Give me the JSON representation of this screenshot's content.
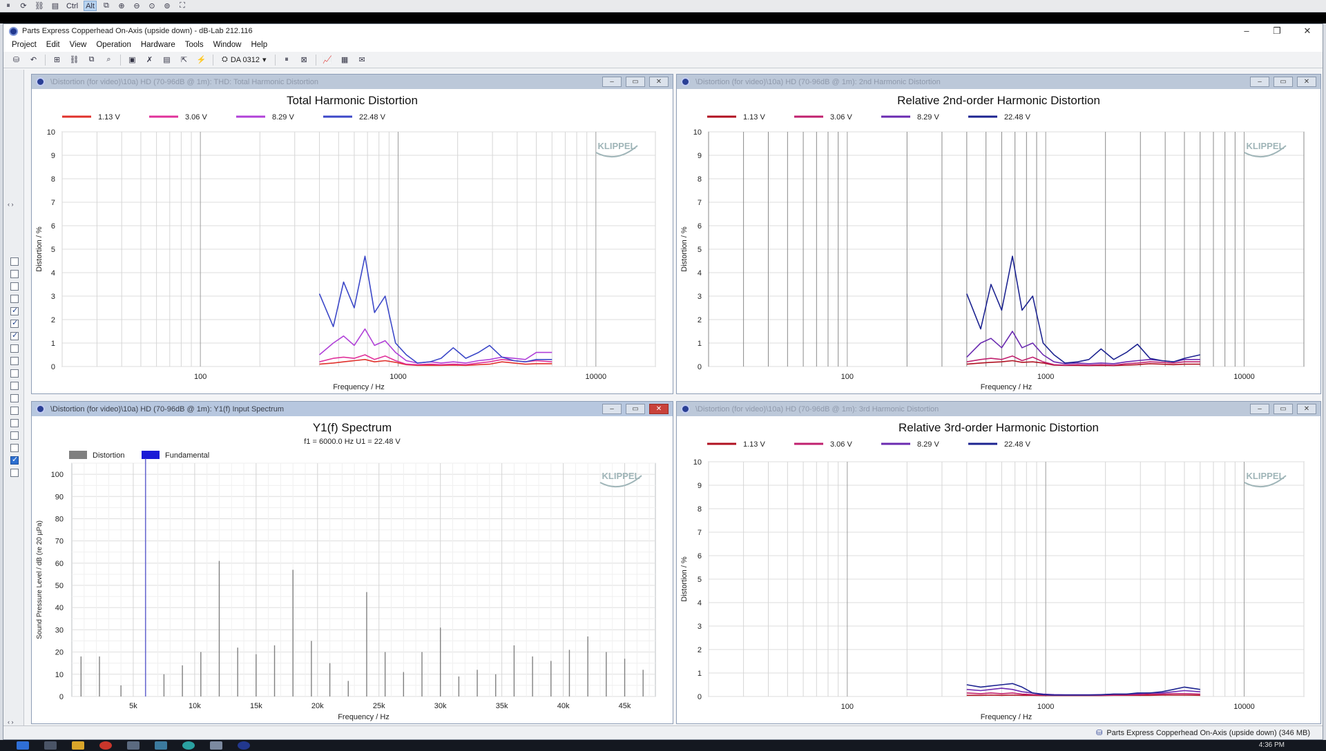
{
  "viewer": {
    "buttons": [
      {
        "name": "pause-icon",
        "glyph": "⏸",
        "on": false
      },
      {
        "name": "refresh-icon",
        "glyph": "⟳",
        "on": false
      },
      {
        "name": "link-icon",
        "glyph": "⛓",
        "on": false
      },
      {
        "name": "clipboard-icon",
        "glyph": "▤",
        "on": false
      },
      {
        "name": "ctrl-key-button",
        "glyph": "Ctrl",
        "on": false
      },
      {
        "name": "alt-key-button",
        "glyph": "Alt",
        "on": true
      },
      {
        "name": "copy-icon",
        "glyph": "⧉",
        "on": false
      },
      {
        "name": "zoom-in-icon",
        "glyph": "⊕",
        "on": false
      },
      {
        "name": "zoom-out-icon",
        "glyph": "⊖",
        "on": false
      },
      {
        "name": "zoom-fit-icon",
        "glyph": "⊙",
        "on": false
      },
      {
        "name": "zoom-actual-icon",
        "glyph": "⊚",
        "on": false
      },
      {
        "name": "fullscreen-icon",
        "glyph": "⛶",
        "on": false
      }
    ]
  },
  "app": {
    "title": "Parts Express Copperhead On-Axis (upside down) - dB-Lab 212.116",
    "win_min": "–",
    "win_max": "❐",
    "win_close": "✕"
  },
  "menu": [
    "Project",
    "Edit",
    "View",
    "Operation",
    "Hardware",
    "Tools",
    "Window",
    "Help"
  ],
  "toolbar": {
    "device": "DA 0312",
    "device_arrow": "▾"
  },
  "windows": {
    "thd": {
      "title": "\\Distortion (for video)\\10a) HD (70-96dB @ 1m): THD: Total Harmonic Distortion",
      "faded": true
    },
    "h2": {
      "title": "\\Distortion (for video)\\10a) HD (70-96dB @ 1m): 2nd Harmonic Distortion",
      "faded": true
    },
    "spectrum": {
      "title": "\\Distortion (for video)\\10a) HD (70-96dB @ 1m): Y1(f) Input Spectrum",
      "faded": false
    },
    "h3": {
      "title": "\\Distortion (for video)\\10a) HD (70-96dB @ 1m): 3rd Harmonic Distortion",
      "faded": true
    },
    "ctl": {
      "min": "–",
      "max": "▭",
      "close": "✕"
    }
  },
  "watermark": "KLIPPEL",
  "colors": {
    "v113": "#e0302b",
    "v306": "#e0309a",
    "v829": "#b040d8",
    "v2248": "#3b47c8",
    "v113_dark": "#b01020",
    "v306_dark": "#c0206e",
    "v829_dark": "#6a2ab0",
    "v2248_dark": "#1c2390",
    "distortion": "#808080",
    "fundamental": "#1a1ad6",
    "grid": "#d0d0d0"
  },
  "chart_data": [
    {
      "type": "line",
      "title": "Total Harmonic Distortion",
      "xlabel": "Frequency / Hz",
      "ylabel": "Distortion / %",
      "xscale": "log",
      "xlim": [
        20,
        20000
      ],
      "ylim": [
        0,
        10
      ],
      "xticks": [
        "100",
        "1000",
        "10000"
      ],
      "yticks": [
        "0",
        "1",
        "2",
        "3",
        "4",
        "5",
        "6",
        "7",
        "8",
        "9",
        "10"
      ],
      "x": [
        400,
        470,
        530,
        600,
        680,
        760,
        860,
        970,
        1100,
        1250,
        1450,
        1650,
        1900,
        2200,
        2550,
        2900,
        3350,
        3850,
        4400,
        5000,
        6000
      ],
      "series": [
        {
          "name": "1.13 V",
          "color_key": "v113",
          "values": [
            0.1,
            0.15,
            0.2,
            0.25,
            0.3,
            0.2,
            0.25,
            0.18,
            0.08,
            0.05,
            0.05,
            0.05,
            0.06,
            0.05,
            0.08,
            0.1,
            0.2,
            0.15,
            0.1,
            0.12,
            0.12
          ]
        },
        {
          "name": "3.06 V",
          "color_key": "v306",
          "values": [
            0.2,
            0.35,
            0.4,
            0.35,
            0.5,
            0.3,
            0.45,
            0.25,
            0.1,
            0.08,
            0.1,
            0.08,
            0.1,
            0.08,
            0.15,
            0.2,
            0.3,
            0.25,
            0.2,
            0.25,
            0.2
          ]
        },
        {
          "name": "8.29 V",
          "color_key": "v829",
          "values": [
            0.5,
            1.0,
            1.3,
            0.9,
            1.6,
            0.9,
            1.1,
            0.6,
            0.25,
            0.15,
            0.2,
            0.15,
            0.2,
            0.15,
            0.25,
            0.3,
            0.4,
            0.35,
            0.3,
            0.6,
            0.6
          ]
        },
        {
          "name": "22.48 V",
          "color_key": "v2248",
          "values": [
            3.1,
            1.7,
            3.6,
            2.5,
            4.7,
            2.3,
            3.0,
            1.0,
            0.5,
            0.15,
            0.2,
            0.35,
            0.8,
            0.35,
            0.6,
            0.9,
            0.4,
            0.25,
            0.2,
            0.3,
            0.3
          ]
        }
      ]
    },
    {
      "type": "line",
      "title": "Relative 2nd-order Harmonic Distortion",
      "xlabel": "Frequency / Hz",
      "ylabel": "Distortion / %",
      "xscale": "log",
      "xlim": [
        20,
        20000
      ],
      "ylim": [
        0,
        10
      ],
      "xticks": [
        "100",
        "1000",
        "10000"
      ],
      "yticks": [
        "0",
        "1",
        "2",
        "3",
        "4",
        "5",
        "6",
        "7",
        "8",
        "9",
        "10"
      ],
      "x": [
        400,
        470,
        530,
        600,
        680,
        760,
        860,
        970,
        1100,
        1250,
        1450,
        1650,
        1900,
        2200,
        2550,
        2900,
        3350,
        3850,
        4400,
        5000,
        6000
      ],
      "series": [
        {
          "name": "1.13 V",
          "color_key": "v113_dark",
          "values": [
            0.1,
            0.15,
            0.18,
            0.2,
            0.25,
            0.18,
            0.2,
            0.15,
            0.06,
            0.05,
            0.05,
            0.04,
            0.05,
            0.04,
            0.06,
            0.08,
            0.12,
            0.1,
            0.08,
            0.1,
            0.1
          ]
        },
        {
          "name": "3.06 V",
          "color_key": "v306_dark",
          "values": [
            0.2,
            0.3,
            0.35,
            0.3,
            0.45,
            0.25,
            0.4,
            0.2,
            0.08,
            0.06,
            0.08,
            0.06,
            0.08,
            0.06,
            0.12,
            0.15,
            0.2,
            0.18,
            0.15,
            0.2,
            0.2
          ]
        },
        {
          "name": "8.29 V",
          "color_key": "v829_dark",
          "values": [
            0.4,
            1.0,
            1.2,
            0.8,
            1.5,
            0.8,
            1.0,
            0.5,
            0.2,
            0.12,
            0.15,
            0.12,
            0.15,
            0.12,
            0.2,
            0.25,
            0.3,
            0.25,
            0.2,
            0.3,
            0.3
          ]
        },
        {
          "name": "22.48 V",
          "color_key": "v2248_dark",
          "values": [
            3.1,
            1.6,
            3.5,
            2.4,
            4.7,
            2.4,
            3.0,
            1.0,
            0.5,
            0.15,
            0.2,
            0.3,
            0.75,
            0.3,
            0.6,
            0.95,
            0.35,
            0.25,
            0.2,
            0.35,
            0.5
          ]
        }
      ]
    },
    {
      "type": "bar",
      "title": "Y1(f) Spectrum",
      "subtitle": "f1 = 6000.0 Hz     U1 = 22.48 V",
      "xlabel": "Frequency / Hz",
      "ylabel": "Sound Pressure Level / dB (re 20 µPa)",
      "xlim": [
        0,
        47500
      ],
      "ylim": [
        0,
        105
      ],
      "xticks": [
        {
          "v": 5000,
          "label": "5k"
        },
        {
          "v": 10000,
          "label": "10k"
        },
        {
          "v": 15000,
          "label": "15k"
        },
        {
          "v": 20000,
          "label": "20k"
        },
        {
          "v": 25000,
          "label": "25k"
        },
        {
          "v": 30000,
          "label": "30k"
        },
        {
          "v": 35000,
          "label": "35k"
        },
        {
          "v": 40000,
          "label": "40k"
        },
        {
          "v": 45000,
          "label": "45k"
        }
      ],
      "yticks": [
        0,
        10,
        20,
        30,
        40,
        50,
        60,
        70,
        80,
        90,
        100
      ],
      "legend": [
        {
          "name": "Distortion",
          "color_key": "distortion"
        },
        {
          "name": "Fundamental",
          "color_key": "fundamental"
        }
      ],
      "fundamental": {
        "x": 6000,
        "value": 107
      },
      "distortion": {
        "x": [
          750,
          2250,
          4000,
          7500,
          9000,
          10500,
          12000,
          13500,
          15000,
          16500,
          18000,
          19500,
          21000,
          22500,
          24000,
          25500,
          27000,
          28500,
          30000,
          31500,
          33000,
          34500,
          36000,
          37500,
          39000,
          40500,
          42000,
          43500,
          45000,
          46500
        ],
        "values": [
          18,
          18,
          5,
          10,
          14,
          20,
          61,
          22,
          19,
          23,
          57,
          25,
          15,
          7,
          47,
          20,
          11,
          20,
          31,
          9,
          12,
          10,
          23,
          18,
          16,
          21,
          27,
          20,
          17,
          12
        ]
      }
    },
    {
      "type": "line",
      "title": "Relative 3rd-order Harmonic Distortion",
      "xlabel": "Frequency / Hz",
      "ylabel": "Distortion / %",
      "xscale": "log",
      "xlim": [
        20,
        20000
      ],
      "ylim": [
        0,
        10
      ],
      "xticks": [
        "100",
        "1000",
        "10000"
      ],
      "yticks": [
        "0",
        "1",
        "2",
        "3",
        "4",
        "5",
        "6",
        "7",
        "8",
        "9",
        "10"
      ],
      "x": [
        400,
        470,
        530,
        600,
        680,
        760,
        860,
        970,
        1100,
        1250,
        1450,
        1650,
        1900,
        2200,
        2550,
        2900,
        3350,
        3850,
        4400,
        5000,
        6000
      ],
      "series": [
        {
          "name": "1.13 V",
          "color_key": "v113_dark",
          "values": [
            0.05,
            0.05,
            0.06,
            0.05,
            0.06,
            0.05,
            0.05,
            0.04,
            0.04,
            0.04,
            0.04,
            0.04,
            0.04,
            0.05,
            0.05,
            0.05,
            0.05,
            0.06,
            0.06,
            0.06,
            0.05
          ]
        },
        {
          "name": "3.06 V",
          "color_key": "v306_dark",
          "values": [
            0.15,
            0.12,
            0.15,
            0.12,
            0.15,
            0.1,
            0.08,
            0.06,
            0.05,
            0.05,
            0.05,
            0.05,
            0.05,
            0.06,
            0.07,
            0.08,
            0.1,
            0.1,
            0.12,
            0.12,
            0.1
          ]
        },
        {
          "name": "8.29 V",
          "color_key": "v829_dark",
          "values": [
            0.3,
            0.25,
            0.3,
            0.35,
            0.3,
            0.2,
            0.15,
            0.1,
            0.08,
            0.07,
            0.07,
            0.07,
            0.08,
            0.1,
            0.1,
            0.12,
            0.15,
            0.15,
            0.2,
            0.25,
            0.2
          ]
        },
        {
          "name": "22.48 V",
          "color_key": "v2248_dark",
          "values": [
            0.5,
            0.4,
            0.45,
            0.5,
            0.55,
            0.4,
            0.15,
            0.08,
            0.06,
            0.06,
            0.06,
            0.06,
            0.07,
            0.1,
            0.1,
            0.15,
            0.15,
            0.2,
            0.3,
            0.4,
            0.3
          ]
        }
      ]
    }
  ],
  "status": {
    "text": "Parts Express Copperhead On-Axis (upside down) (346 MB)"
  },
  "clock": "4:36 PM"
}
